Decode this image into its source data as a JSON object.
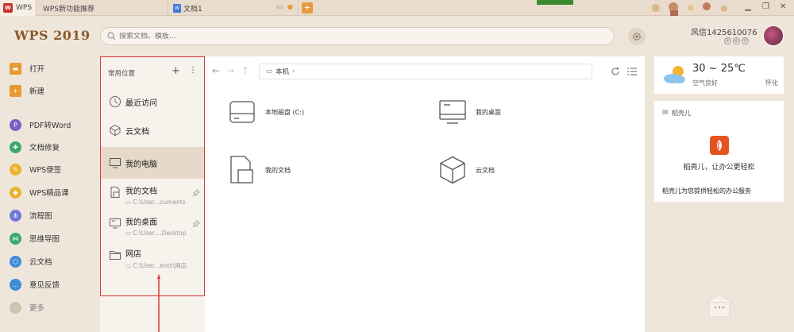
{
  "tabs": [
    {
      "label": "WPS"
    },
    {
      "label": "WPS新功能推荐"
    },
    {
      "label": "文档1"
    }
  ],
  "brand": "WPS 2019",
  "search": {
    "placeholder": "搜索文档、模板..."
  },
  "user": {
    "name": "风信1425610076",
    "badges": [
      "④",
      "⑥",
      "⑤"
    ]
  },
  "nav": [
    {
      "label": "打开",
      "icon": "folder-icon",
      "color": "#e69a34"
    },
    {
      "label": "新建",
      "icon": "plus-icon",
      "color": "#e69a34"
    },
    {
      "label": "PDF转Word",
      "icon": "pdf-icon",
      "color": "#7c5cc7"
    },
    {
      "label": "文档修复",
      "icon": "repair-icon",
      "color": "#3aa86b"
    },
    {
      "label": "WPS便签",
      "icon": "note-icon",
      "color": "#e8b42f"
    },
    {
      "label": "WPS精品课",
      "icon": "course-icon",
      "color": "#e8b42f"
    },
    {
      "label": "流程图",
      "icon": "flowchart-icon",
      "color": "#6f78d6"
    },
    {
      "label": "思维导图",
      "icon": "mindmap-icon",
      "color": "#3aa86b"
    },
    {
      "label": "云文档",
      "icon": "cloud-cube-icon",
      "color": "#3d8bd9"
    },
    {
      "label": "意见反馈",
      "icon": "feedback-icon",
      "color": "#3d8bd9"
    },
    {
      "label": "更多",
      "icon": "more-icon",
      "color": "#cfc3b4"
    }
  ],
  "panel": {
    "title": "常用位置",
    "locations": [
      {
        "label": "最近访问",
        "sub": ""
      },
      {
        "label": "云文档",
        "sub": ""
      },
      {
        "label": "我的电脑",
        "sub": ""
      },
      {
        "label": "我的文档",
        "sub": "C:\\User...cuments"
      },
      {
        "label": "我的桌面",
        "sub": "C:\\User....Desktop"
      },
      {
        "label": "网店",
        "sub": "C:\\User...ents\\网店"
      }
    ]
  },
  "path": {
    "label": "本机"
  },
  "items": [
    {
      "label": "本地磁盘 (C:)",
      "icon": "disk-icon"
    },
    {
      "label": "我的桌面",
      "icon": "desktop-icon"
    },
    {
      "label": "我的文档",
      "icon": "documents-icon"
    },
    {
      "label": "云文档",
      "icon": "cloud-cube-icon"
    }
  ],
  "weather": {
    "temp": "30 ~ 25℃",
    "air": "空气良好",
    "city": "怀化"
  },
  "dok": {
    "title": "稻壳儿",
    "slogan": "稻壳儿，让办公更轻松",
    "service": "稻壳儿为您提供轻松的办公服务"
  },
  "colors": {
    "accent": "#e69a34",
    "highlight": "#d63a3a",
    "bg": "#efe6db"
  }
}
